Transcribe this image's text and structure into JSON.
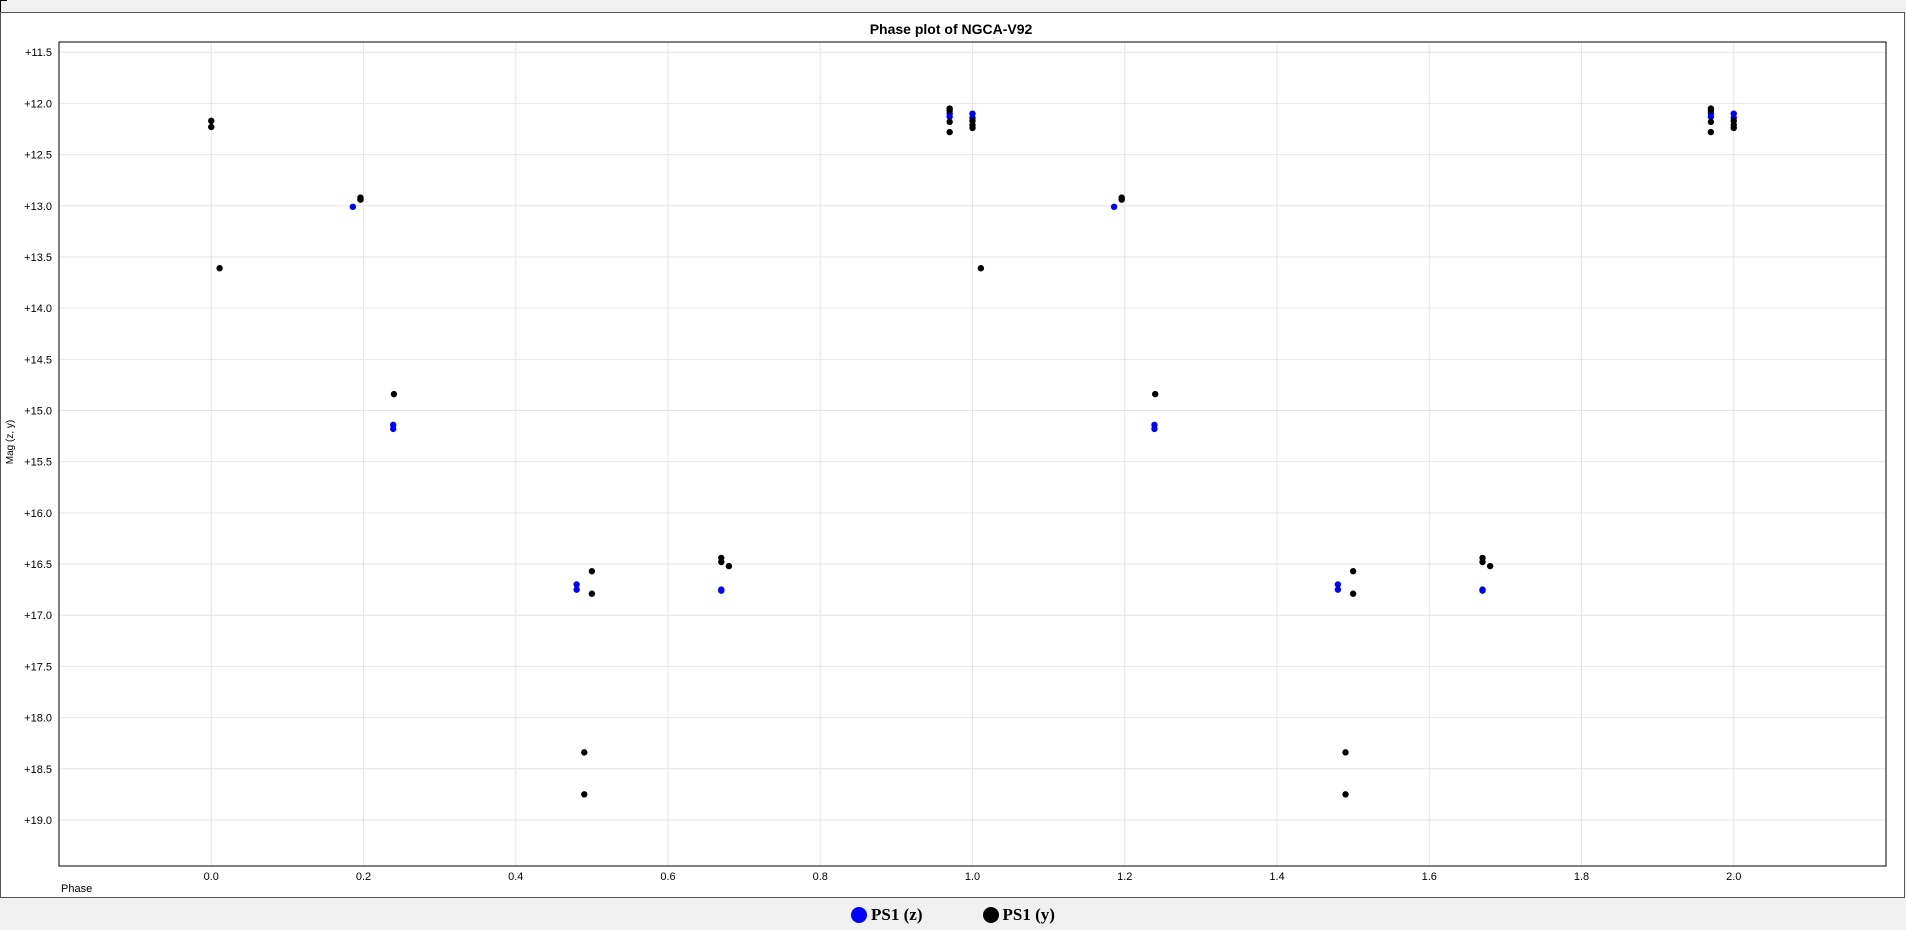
{
  "chart_data": {
    "type": "scatter",
    "title": "Phase plot of NGCA-V92",
    "xlabel": "Phase",
    "ylabel": "Mag (z, y)",
    "xlim": [
      -0.2,
      2.2
    ],
    "ylim": [
      11.4,
      19.45
    ],
    "y_inverted": true,
    "grid": true,
    "legend_position": "bottom-center",
    "x_ticks": [
      0.0,
      0.2,
      0.4,
      0.6,
      0.8,
      1.0,
      1.2,
      1.4,
      1.6,
      1.8,
      2.0
    ],
    "x_tick_labels": [
      "0.0",
      "0.2",
      "0.4",
      "0.6",
      "0.8",
      "1.0",
      "1.2",
      "1.4",
      "1.6",
      "1.8",
      "2.0"
    ],
    "y_ticks": [
      11.5,
      12.0,
      12.5,
      13.0,
      13.5,
      14.0,
      14.5,
      15.0,
      15.5,
      16.0,
      16.5,
      17.0,
      17.5,
      18.0,
      18.5,
      19.0
    ],
    "y_tick_labels": [
      "+11.5",
      "+12.0",
      "+12.5",
      "+13.0",
      "+13.5",
      "+14.0",
      "+14.5",
      "+15.0",
      "+15.5",
      "+16.0",
      "+16.5",
      "+17.0",
      "+17.5",
      "+18.0",
      "+18.5",
      "+19.0"
    ],
    "series": [
      {
        "name": "PS1 (z)",
        "color": "#0000ff",
        "points": [
          [
            0.186,
            13.01
          ],
          [
            0.239,
            15.14
          ],
          [
            0.239,
            15.18
          ],
          [
            0.48,
            16.7
          ],
          [
            0.48,
            16.75
          ],
          [
            0.67,
            16.75
          ],
          [
            0.67,
            16.76
          ],
          [
            0.97,
            12.1
          ],
          [
            0.97,
            12.13
          ],
          [
            1.0,
            12.1
          ],
          [
            1.0,
            12.14
          ],
          [
            1.186,
            13.01
          ],
          [
            1.239,
            15.14
          ],
          [
            1.239,
            15.18
          ],
          [
            1.48,
            16.7
          ],
          [
            1.48,
            16.75
          ],
          [
            1.67,
            16.75
          ],
          [
            1.67,
            16.76
          ],
          [
            1.97,
            12.1
          ],
          [
            1.97,
            12.13
          ],
          [
            2.0,
            12.1
          ],
          [
            2.0,
            12.14
          ]
        ]
      },
      {
        "name": "PS1 (y)",
        "color": "#000000",
        "points": [
          [
            0.0,
            12.17
          ],
          [
            0.0,
            12.23
          ],
          [
            0.011,
            13.61
          ],
          [
            0.196,
            12.92
          ],
          [
            0.196,
            12.94
          ],
          [
            0.24,
            14.84
          ],
          [
            0.49,
            18.34
          ],
          [
            0.49,
            18.75
          ],
          [
            0.5,
            16.57
          ],
          [
            0.5,
            16.79
          ],
          [
            0.67,
            16.44
          ],
          [
            0.67,
            16.48
          ],
          [
            0.68,
            16.52
          ],
          [
            0.97,
            12.05
          ],
          [
            0.97,
            12.07
          ],
          [
            0.97,
            12.18
          ],
          [
            0.97,
            12.28
          ],
          [
            1.0,
            12.17
          ],
          [
            1.0,
            12.21
          ],
          [
            1.0,
            12.24
          ],
          [
            1.011,
            13.61
          ],
          [
            1.196,
            12.92
          ],
          [
            1.196,
            12.94
          ],
          [
            1.24,
            14.84
          ],
          [
            1.49,
            18.34
          ],
          [
            1.49,
            18.75
          ],
          [
            1.5,
            16.57
          ],
          [
            1.5,
            16.79
          ],
          [
            1.67,
            16.44
          ],
          [
            1.67,
            16.48
          ],
          [
            1.68,
            16.52
          ],
          [
            1.97,
            12.05
          ],
          [
            1.97,
            12.07
          ],
          [
            1.97,
            12.18
          ],
          [
            1.97,
            12.28
          ],
          [
            2.0,
            12.17
          ],
          [
            2.0,
            12.21
          ],
          [
            2.0,
            12.24
          ]
        ]
      }
    ]
  },
  "legend": {
    "items": [
      {
        "label": "PS1 (z)",
        "color": "#0000ff"
      },
      {
        "label": "PS1 (y)",
        "color": "#000000"
      }
    ]
  }
}
